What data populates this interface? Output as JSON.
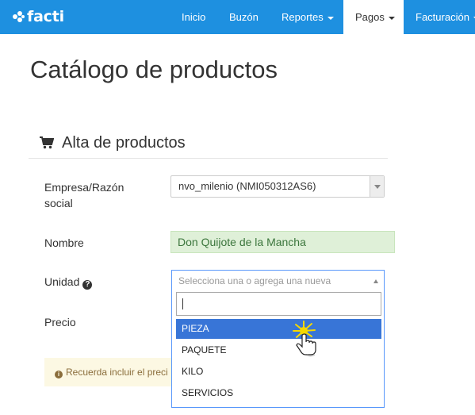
{
  "navbar": {
    "brand": "facti",
    "items": [
      {
        "label": "Inicio",
        "dropdown": false,
        "active": false
      },
      {
        "label": "Buzón",
        "dropdown": false,
        "active": false
      },
      {
        "label": "Reportes",
        "dropdown": true,
        "active": false
      },
      {
        "label": "Pagos",
        "dropdown": true,
        "active": true
      },
      {
        "label": "Facturación",
        "dropdown": true,
        "active": false
      }
    ]
  },
  "page": {
    "title": "Catálogo de productos",
    "section_title": "Alta de productos",
    "section_icon": "shopping-cart-icon"
  },
  "form": {
    "empresa_label": "Empresa/Razón social",
    "empresa_value": "nvo_milenio (NMI050312AS6)",
    "nombre_label": "Nombre",
    "nombre_value": "Don Quijote de la Mancha",
    "unidad_label": "Unidad",
    "unidad_help_icon": "question-circle-icon",
    "unidad_placeholder": "Selecciona una o agrega una nueva",
    "unidad_search_value": "",
    "unidad_options": [
      "PIEZA",
      "PAQUETE",
      "KILO",
      "SERVICIOS"
    ],
    "unidad_highlighted": "PIEZA",
    "precio_label": "Precio"
  },
  "alert": {
    "icon": "info-circle-icon",
    "text": "Recuerda incluir el preci"
  },
  "colors": {
    "navbar": "#1e90e0",
    "valid_field_bg": "#dff0d8",
    "valid_field_text": "#3c763d",
    "option_highlight": "#3875d7",
    "alert_bg": "#fcf8e3"
  }
}
